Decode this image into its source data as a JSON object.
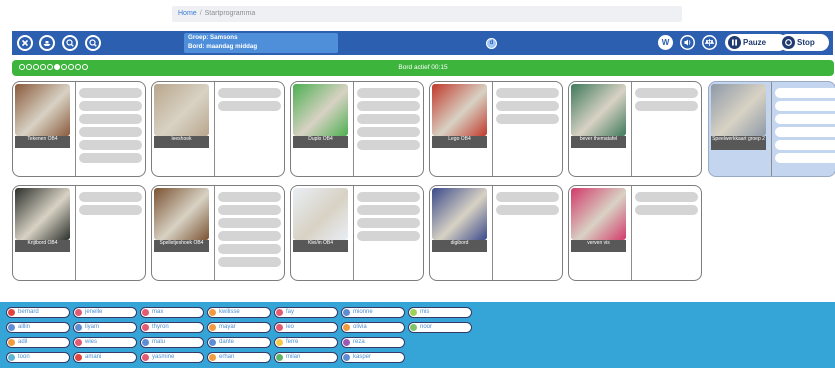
{
  "breadcrumb": {
    "home": "Home",
    "separator": "/",
    "current": "Startprogramma"
  },
  "toolbar": {
    "left_buttons": [
      {
        "name": "close-icon",
        "color": "#2c5fb0"
      },
      {
        "name": "boat-icon",
        "color": "#2c5fb0"
      },
      {
        "name": "zoom-out-icon",
        "color": "#2c5fb0"
      },
      {
        "name": "zoom-in-icon",
        "color": "#2c5fb0"
      }
    ],
    "group_line": "Groep: Samsons",
    "bord_line": "Bord: maandag middag",
    "info_badge": "d",
    "w_label": "W",
    "pause_label": "Pauze",
    "stop_label": "Stop"
  },
  "status": {
    "bord_actief": "Bord actief 00:15",
    "dots_total": 10,
    "dots_active_index": 5
  },
  "activities": [
    {
      "label": "Tekenen OB4",
      "slots": 6,
      "color": "#8a5a3c",
      "selected": false
    },
    {
      "label": "leeshoek",
      "slots": 2,
      "color": "#b9a68c",
      "selected": false
    },
    {
      "label": "Duplo OB4",
      "slots": 5,
      "color": "#4caf50",
      "selected": false
    },
    {
      "label": "Lego OB4",
      "slots": 3,
      "color": "#c0392b",
      "selected": false
    },
    {
      "label": "bever thematafel",
      "slots": 2,
      "color": "#3f7a5c",
      "selected": false
    },
    {
      "label": "Speelwerkkaart groep 2",
      "slots": 6,
      "color": "#8e9aa8",
      "selected": true
    },
    {
      "label": "Krijtbord OB4",
      "slots": 2,
      "color": "#2b2f2b",
      "selected": false
    },
    {
      "label": "Spelletjeshoek OB4",
      "slots": 6,
      "color": "#7a5232",
      "selected": false
    },
    {
      "label": "Klei/in OB4",
      "slots": 4,
      "color": "#e9eef5",
      "selected": false
    },
    {
      "label": "digibord",
      "slots": 2,
      "color": "#3b4a8a",
      "selected": false
    },
    {
      "label": "verven vis",
      "slots": 2,
      "color": "#d23a6a",
      "selected": false
    }
  ],
  "children": [
    {
      "name": "bernard",
      "color": "#e0443c"
    },
    {
      "name": "jenelle",
      "color": "#e35b73"
    },
    {
      "name": "max",
      "color": "#e35b73"
    },
    {
      "name": "kwilisse",
      "color": "#f19a3e"
    },
    {
      "name": "fay",
      "color": "#e35b73"
    },
    {
      "name": "mionne",
      "color": "#5f8dd4"
    },
    {
      "name": "mis",
      "color": "#9fd15a"
    },
    {
      "name": "alllin",
      "color": "#5f8dd4"
    },
    {
      "name": "liyam",
      "color": "#5f8dd4"
    },
    {
      "name": "thyron",
      "color": "#e35b73"
    },
    {
      "name": "mayar",
      "color": "#f19a3e"
    },
    {
      "name": "leo",
      "color": "#e35b73"
    },
    {
      "name": "olivia",
      "color": "#f19a3e"
    },
    {
      "name": "noor",
      "color": "#7cc36b"
    },
    {
      "name": "adil",
      "color": "#f19a3e"
    },
    {
      "name": "wies",
      "color": "#e35b73"
    },
    {
      "name": "malu",
      "color": "#5f8dd4"
    },
    {
      "name": "dante",
      "color": "#5f8dd4"
    },
    {
      "name": "ferre",
      "color": "#f5c94a"
    },
    {
      "name": "reza",
      "color": "#9b59b6"
    },
    {
      "name": "toon",
      "color": "#5fb4d4"
    },
    {
      "name": "amani",
      "color": "#e0443c"
    },
    {
      "name": "yasmine",
      "color": "#e35b73"
    },
    {
      "name": "erhan",
      "color": "#f19a3e"
    },
    {
      "name": "milan",
      "color": "#5fb46b"
    },
    {
      "name": "kasper",
      "color": "#5f8dd4"
    }
  ]
}
